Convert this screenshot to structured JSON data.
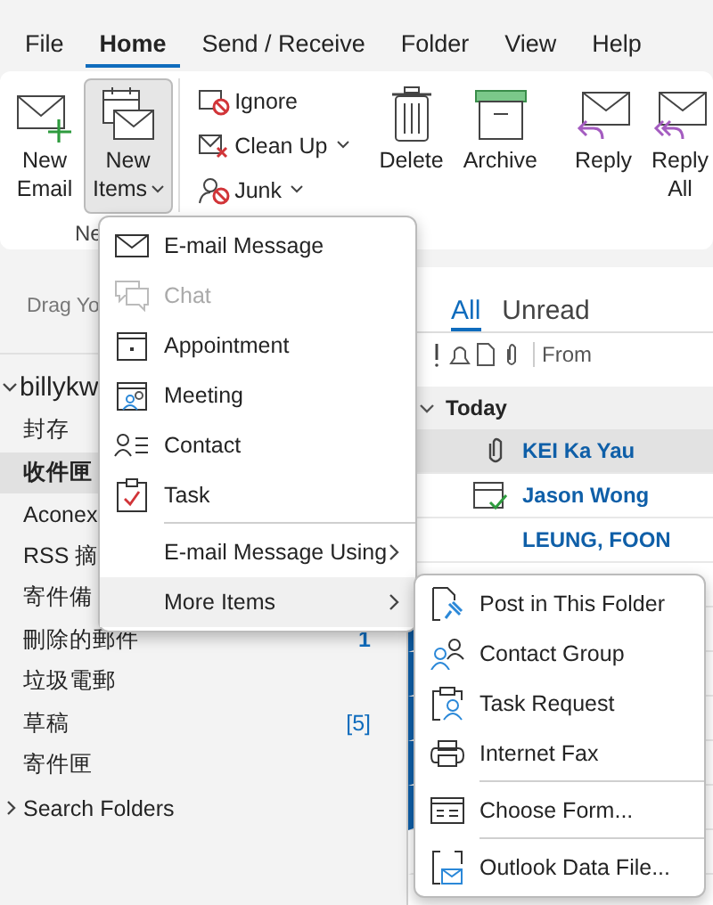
{
  "menu_bar": [
    {
      "label": "File",
      "selected": false
    },
    {
      "label": "Home",
      "selected": true
    },
    {
      "label": "Send / Receive",
      "selected": false
    },
    {
      "label": "Folder",
      "selected": false
    },
    {
      "label": "View",
      "selected": false
    },
    {
      "label": "Help",
      "selected": false
    }
  ],
  "ribbon": {
    "group_label": "Ne",
    "large_buttons": [
      {
        "kind": "new-email",
        "lines": [
          "New",
          "Email"
        ],
        "dropdown": false,
        "selected": false
      },
      {
        "kind": "new-items",
        "lines": [
          "New",
          "Items"
        ],
        "dropdown": true,
        "selected": true
      },
      {
        "kind": "delete",
        "lines": [
          "Delete"
        ],
        "dropdown": false,
        "selected": false
      },
      {
        "kind": "archive",
        "lines": [
          "Archive"
        ],
        "dropdown": false,
        "selected": false
      },
      {
        "kind": "reply",
        "lines": [
          "Reply"
        ],
        "dropdown": false,
        "selected": false
      },
      {
        "kind": "reply-all",
        "lines": [
          "Reply",
          "All"
        ],
        "dropdown": false,
        "selected": false
      }
    ],
    "small_buttons": [
      {
        "kind": "ignore",
        "label": "Ignore",
        "dropdown": false
      },
      {
        "kind": "clean-up",
        "label": "Clean Up",
        "dropdown": true
      },
      {
        "kind": "junk",
        "label": "Junk",
        "dropdown": true
      }
    ]
  },
  "folder_pane": {
    "drag_hint": "Drag Yo",
    "account": {
      "name": "billykw",
      "expanded": true
    },
    "folders": [
      {
        "name": "封存",
        "selected": false
      },
      {
        "name": "收件匣",
        "selected": true
      },
      {
        "name": "Aconex",
        "selected": false
      },
      {
        "name": "RSS 摘",
        "selected": false
      },
      {
        "name": "寄件備",
        "selected": false
      },
      {
        "name": "刪除的郵件",
        "count": "1",
        "bold": true,
        "selected": false
      },
      {
        "name": "垃圾電郵",
        "selected": false
      },
      {
        "name": "草稿",
        "count": "[5]",
        "bold": false,
        "selected": false
      },
      {
        "name": "寄件匣",
        "selected": false
      }
    ],
    "search_folders": {
      "label": "Search Folders",
      "expanded": false
    }
  },
  "mail_list": {
    "tabs": [
      {
        "label": "All",
        "selected": true
      },
      {
        "label": "Unread",
        "selected": false
      }
    ],
    "column_from": "From",
    "group": {
      "label": "Today",
      "expanded": true
    },
    "rows": [
      {
        "from": "KEI Ka Yau",
        "attachment": true,
        "meeting": false,
        "selected": true
      },
      {
        "from": "Jason Wong",
        "attachment": false,
        "meeting": true,
        "selected": false
      },
      {
        "from": "LEUNG, FOON",
        "attachment": false,
        "meeting": false,
        "selected": false
      },
      {
        "selected": false
      },
      {
        "unread": true,
        "selected": false
      },
      {
        "unread": true,
        "selected": false
      },
      {
        "unread": true,
        "selected": false
      },
      {
        "unread": true,
        "selected": false
      },
      {
        "unread": true,
        "selected": false
      },
      {
        "unread": false,
        "selected": false
      }
    ]
  },
  "new_items_menu": [
    {
      "kind": "mail",
      "label": "E-mail Message",
      "disabled": false,
      "submenu": false,
      "selected": false,
      "separator_before": false
    },
    {
      "kind": "chat",
      "label": "Chat",
      "disabled": true,
      "submenu": false,
      "selected": false,
      "separator_before": false
    },
    {
      "kind": "appointment",
      "label": "Appointment",
      "disabled": false,
      "submenu": false,
      "selected": false,
      "separator_before": false
    },
    {
      "kind": "meeting",
      "label": "Meeting",
      "disabled": false,
      "submenu": false,
      "selected": false,
      "separator_before": false
    },
    {
      "kind": "contact",
      "label": "Contact",
      "disabled": false,
      "submenu": false,
      "selected": false,
      "separator_before": false
    },
    {
      "kind": "task",
      "label": "Task",
      "disabled": false,
      "submenu": false,
      "selected": false,
      "separator_before": false
    },
    {
      "kind": "none",
      "label": "E-mail Message Using",
      "disabled": false,
      "submenu": true,
      "selected": false,
      "separator_before": true
    },
    {
      "kind": "none",
      "label": "More Items",
      "disabled": false,
      "submenu": true,
      "selected": true,
      "separator_before": false
    }
  ],
  "more_items_menu": [
    {
      "kind": "post",
      "label": "Post in This Folder",
      "separator_before": false
    },
    {
      "kind": "contact-group",
      "label": "Contact Group",
      "separator_before": false
    },
    {
      "kind": "task-request",
      "label": "Task Request",
      "separator_before": false
    },
    {
      "kind": "fax",
      "label": "Internet Fax",
      "separator_before": false
    },
    {
      "kind": "form",
      "label": "Choose Form...",
      "separator_before": true
    },
    {
      "kind": "data-file",
      "label": "Outlook Data File...",
      "separator_before": true
    }
  ]
}
